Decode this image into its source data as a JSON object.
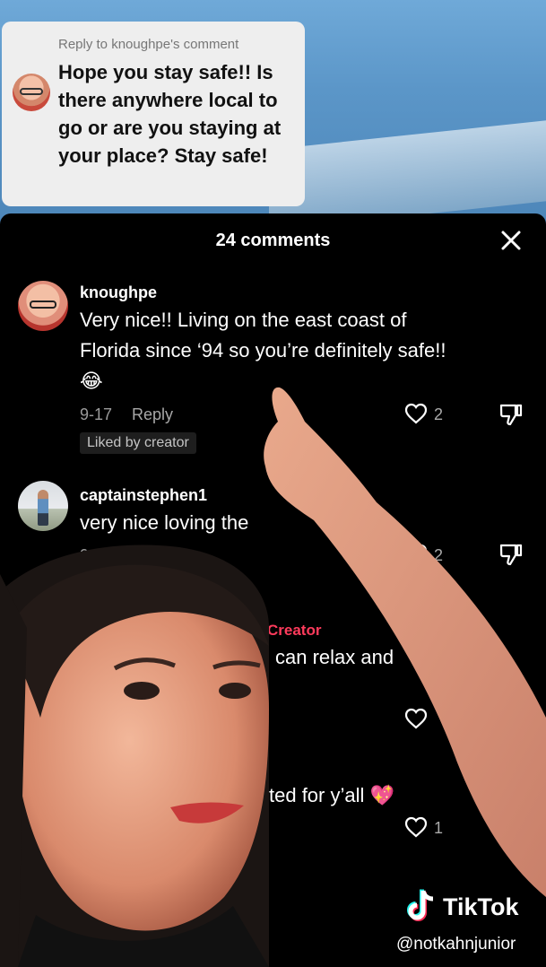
{
  "sticker": {
    "header": "Reply to knoughpe's comment",
    "body": "Hope you stay safe!! Is there anywhere local to go or are you staying at your place? Stay safe!"
  },
  "sheet": {
    "title": "24 comments",
    "comments": [
      {
        "username": "knoughpe",
        "text": "Very nice!! Living on the east coast of Florida since ‘94 so you’re definitely safe!! 😂",
        "date": "9-17",
        "reply_label": "Reply",
        "likes": "2",
        "badge": "Liked by creator"
      },
      {
        "username": "captainstephen1",
        "text": "very nice loving the",
        "date": "9-17",
        "likes": "2"
      },
      {
        "tag": "Creator",
        "text": "l can relax and"
      },
      {
        "text": "ted for y’all 💖",
        "likes": "1"
      }
    ]
  },
  "watermark": {
    "brand": "TikTok",
    "handle": "@notkahnjunior"
  },
  "colors": {
    "creator_tag": "#ff3b5c",
    "sheet_bg": "#000000",
    "sticker_bg": "#eeeeee"
  },
  "icons": [
    "close-icon",
    "heart-icon",
    "dislike-icon",
    "tiktok-logo-icon"
  ]
}
